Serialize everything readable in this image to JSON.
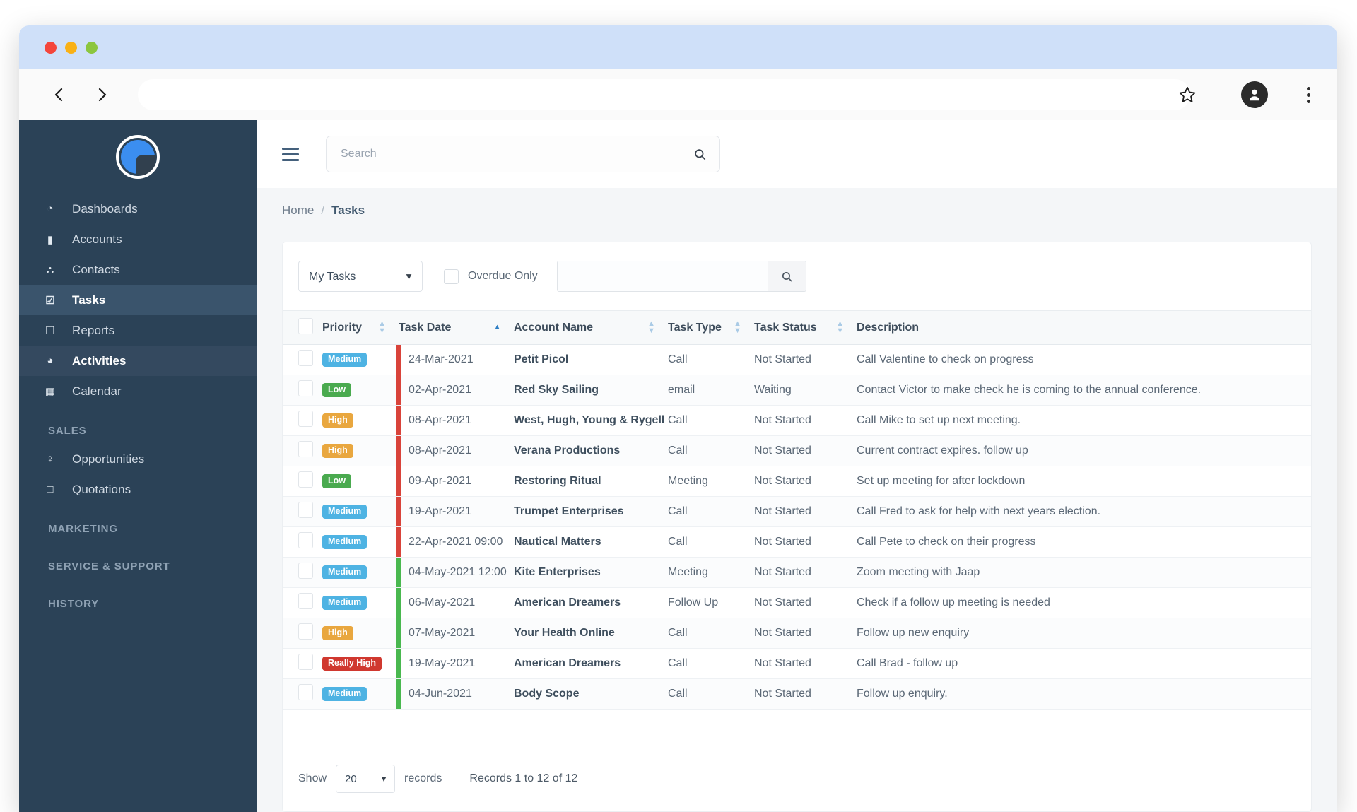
{
  "browser": {
    "url_value": "",
    "url_placeholder": "",
    "back_label": "‹",
    "forward_label": "›"
  },
  "app": {
    "search": {
      "placeholder": "Search",
      "value": ""
    },
    "breadcrumb": {
      "home": "Home",
      "separator": "/",
      "current": "Tasks"
    }
  },
  "sidebar": {
    "items": [
      {
        "label": "Dashboards",
        "icon": "dashboard-icon",
        "glyph": "◔",
        "state": ""
      },
      {
        "label": "Accounts",
        "icon": "briefcase-icon",
        "glyph": "▮",
        "state": ""
      },
      {
        "label": "Contacts",
        "icon": "people-icon",
        "glyph": "⛬",
        "state": ""
      },
      {
        "label": "Tasks",
        "icon": "check-square-icon",
        "glyph": "☑",
        "state": "active"
      },
      {
        "label": "Reports",
        "icon": "copy-icon",
        "glyph": "❐",
        "state": ""
      },
      {
        "label": "Activities",
        "icon": "comments-icon",
        "glyph": "◕",
        "state": "hover"
      },
      {
        "label": "Calendar",
        "icon": "calendar-icon",
        "glyph": "▦",
        "state": ""
      }
    ],
    "groups": [
      {
        "title": "SALES",
        "items": [
          {
            "label": "Opportunities",
            "icon": "lightbulb-icon",
            "glyph": "♀"
          },
          {
            "label": "Quotations",
            "icon": "file-icon",
            "glyph": "□"
          }
        ]
      },
      {
        "title": "MARKETING",
        "items": []
      },
      {
        "title": "SERVICE & SUPPORT",
        "items": []
      },
      {
        "title": "HISTORY",
        "items": []
      }
    ]
  },
  "filters": {
    "view_selected": "My Tasks",
    "view_options": [
      "My Tasks"
    ],
    "overdue_label": "Overdue Only",
    "overdue_checked": false,
    "quick_search_value": "",
    "quick_search_placeholder": ""
  },
  "table": {
    "columns": [
      {
        "key": "checkbox",
        "label": "",
        "sort": "none"
      },
      {
        "key": "priority",
        "label": "Priority",
        "sort": "both"
      },
      {
        "key": "task_date",
        "label": "Task Date",
        "sort": "asc"
      },
      {
        "key": "account",
        "label": "Account Name",
        "sort": "both"
      },
      {
        "key": "task_type",
        "label": "Task Type",
        "sort": "both"
      },
      {
        "key": "task_status",
        "label": "Task Status",
        "sort": "both"
      },
      {
        "key": "description",
        "label": "Description",
        "sort": "none"
      }
    ],
    "rows": [
      {
        "priority": "Medium",
        "priority_class": "medium",
        "flag": "red",
        "task_date": "24-Mar-2021",
        "account": "Petit Picol",
        "task_type": "Call",
        "task_status": "Not Started",
        "description": "Call Valentine to check on progress"
      },
      {
        "priority": "Low",
        "priority_class": "low",
        "flag": "red",
        "task_date": "02-Apr-2021",
        "account": "Red Sky Sailing",
        "task_type": "email",
        "task_status": "Waiting",
        "description": "Contact Victor to make check he is coming to the annual conference."
      },
      {
        "priority": "High",
        "priority_class": "high",
        "flag": "red",
        "task_date": "08-Apr-2021",
        "account": "West, Hugh, Young & Rygell",
        "task_type": "Call",
        "task_status": "Not Started",
        "description": "Call Mike to set up next meeting."
      },
      {
        "priority": "High",
        "priority_class": "high",
        "flag": "red",
        "task_date": "08-Apr-2021",
        "account": "Verana Productions",
        "task_type": "Call",
        "task_status": "Not Started",
        "description": "Current contract expires. follow up"
      },
      {
        "priority": "Low",
        "priority_class": "low",
        "flag": "red",
        "task_date": "09-Apr-2021",
        "account": "Restoring Ritual",
        "task_type": "Meeting",
        "task_status": "Not Started",
        "description": "Set up meeting for after lockdown"
      },
      {
        "priority": "Medium",
        "priority_class": "medium",
        "flag": "red",
        "task_date": "19-Apr-2021",
        "account": "Trumpet Enterprises",
        "task_type": "Call",
        "task_status": "Not Started",
        "description": "Call Fred to ask for help with next years election."
      },
      {
        "priority": "Medium",
        "priority_class": "medium",
        "flag": "red",
        "task_date": "22-Apr-2021 09:00",
        "account": "Nautical Matters",
        "task_type": "Call",
        "task_status": "Not Started",
        "description": "Call Pete to check on their progress"
      },
      {
        "priority": "Medium",
        "priority_class": "medium",
        "flag": "green",
        "task_date": "04-May-2021 12:00",
        "account": "Kite Enterprises",
        "task_type": "Meeting",
        "task_status": "Not Started",
        "description": "Zoom meeting with Jaap"
      },
      {
        "priority": "Medium",
        "priority_class": "medium",
        "flag": "green",
        "task_date": "06-May-2021",
        "account": "American Dreamers",
        "task_type": "Follow Up",
        "task_status": "Not Started",
        "description": "Check if a follow up meeting is needed"
      },
      {
        "priority": "High",
        "priority_class": "high",
        "flag": "green",
        "task_date": "07-May-2021",
        "account": "Your Health Online",
        "task_type": "Call",
        "task_status": "Not Started",
        "description": "Follow up new enquiry"
      },
      {
        "priority": "Really High",
        "priority_class": "really-high",
        "flag": "green",
        "task_date": "19-May-2021",
        "account": "American Dreamers",
        "task_type": "Call",
        "task_status": "Not Started",
        "description": "Call Brad - follow up"
      },
      {
        "priority": "Medium",
        "priority_class": "medium",
        "flag": "green",
        "task_date": "04-Jun-2021",
        "account": "Body Scope",
        "task_type": "Call",
        "task_status": "Not Started",
        "description": "Follow up enquiry."
      }
    ]
  },
  "footer": {
    "show_label": "Show",
    "page_size": "20",
    "page_size_options": [
      "20"
    ],
    "records_label": "records",
    "record_info": "Records 1 to 12 of 12"
  },
  "colors": {
    "sidebar_bg": "#2b4257",
    "sidebar_active": "#3a546c",
    "titlebar": "#cfe0f9",
    "badge_medium": "#4eb3e3",
    "badge_low": "#4aaa4f",
    "badge_high": "#e9a73f",
    "badge_really_high": "#d0382f",
    "flag_overdue": "#d9433a",
    "flag_upcoming": "#49b84f"
  }
}
